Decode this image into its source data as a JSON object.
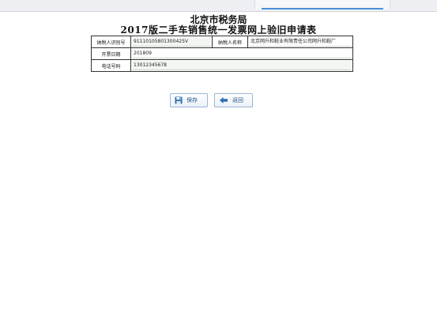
{
  "header": {
    "line1": "北京市税务局",
    "line2": "2017版二手车销售统一发票网上验旧申请表"
  },
  "form": {
    "taxpayer_id_label": "纳税人识别号",
    "taxpayer_id_value": "91110105801300425V",
    "taxpayer_name_label": "纳税人名称",
    "taxpayer_name_value": "北京网升和鞋业有限责任公司网升和鞋厂",
    "invoice_date_label": "开票日期",
    "invoice_date_value": "201809",
    "phone_label": "电话号码",
    "phone_value": "13012345678"
  },
  "actions": {
    "save_label": "保存",
    "back_label": "返回",
    "save_icon": "floppy-disk-icon",
    "back_icon": "arrow-left-icon"
  },
  "colors": {
    "accent": "#2a5a8c",
    "button_border": "#9bb7d4"
  }
}
